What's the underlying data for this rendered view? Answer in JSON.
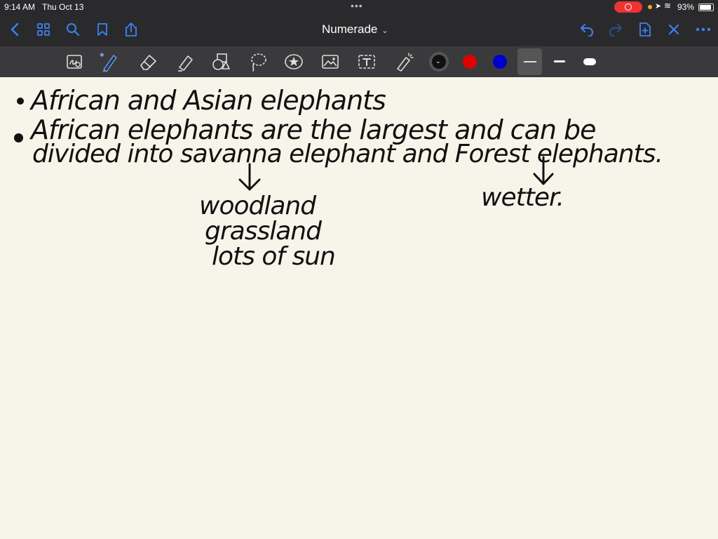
{
  "status_bar": {
    "time": "9:14 AM",
    "date": "Thu Oct 13",
    "battery": "93%"
  },
  "nav": {
    "title": "Numerade",
    "icons": [
      "back-icon",
      "grid-icon",
      "search-icon",
      "bookmark-icon",
      "share-icon",
      "undo-icon",
      "redo-icon",
      "add-page-icon",
      "close-icon",
      "more-icon"
    ]
  },
  "toolbar": {
    "tools": [
      "lasso-ocr-tool",
      "pen-tool",
      "eraser-tool",
      "highlighter-tool",
      "shapes-tool",
      "lasso-tool",
      "sticker-tool",
      "image-tool",
      "text-tool",
      "laser-pointer-tool"
    ],
    "colors": [
      "#111111",
      "#e00000",
      "#0000cc"
    ]
  },
  "notes": {
    "line1": "African and Asian elephants",
    "line2": "African elephants are the largest and can be",
    "line3": "divided into savanna elephant and Forest elephants.",
    "savanna_1": "woodland",
    "savanna_2": "grassland",
    "savanna_3": "lots of sun",
    "forest_1": "wetter."
  }
}
